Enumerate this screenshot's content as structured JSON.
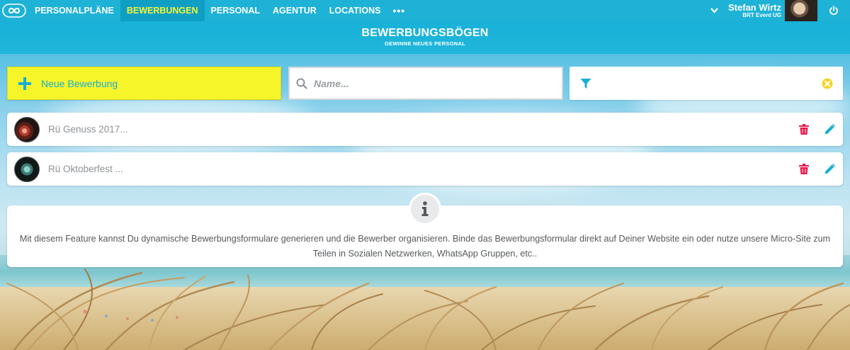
{
  "nav": {
    "items": [
      {
        "label": "PERSONALPLÄNE",
        "active": false
      },
      {
        "label": "BEWERBUNGEN",
        "active": true
      },
      {
        "label": "PERSONAL",
        "active": false
      },
      {
        "label": "AGENTUR",
        "active": false
      },
      {
        "label": "LOCATIONS",
        "active": false
      }
    ],
    "more": "•••",
    "user_name": "Stefan Wirtz",
    "user_company": "BRT Event UG"
  },
  "header": {
    "title": "BEWERBUNGSBÖGEN",
    "subtitle": "GEWINNE NEUES PERSONAL"
  },
  "toolbar": {
    "new_label": "Neue Bewerbung",
    "search_placeholder": "Name...",
    "search_value": ""
  },
  "list": [
    {
      "title": "Rü Genuss 2017..."
    },
    {
      "title": "Rü Oktoberfest ..."
    }
  ],
  "info": {
    "text": "Mit diesem Feature kannst Du dynamische Bewerbungsformulare generieren und die Bewerber organisieren. Binde das Bewerbungsformular direkt auf Deiner Website ein oder nutze unsere Micro-Site zum Teilen in Sozialen Netzwerken, WhatsApp Gruppen, etc.."
  },
  "colors": {
    "nav_bg": "#1eb2d6",
    "active_text": "#f5f533",
    "new_button_bg": "#f6f52a",
    "accent": "#19aed3",
    "delete": "#e8174b",
    "clear": "#f2d52a"
  },
  "icons": {
    "logo": "infinity-logo-icon",
    "chevron": "chevron-down-icon",
    "power": "power-icon",
    "plus": "plus-icon",
    "search": "search-icon",
    "filter": "filter-icon",
    "clear": "clear-circle-icon",
    "trash": "trash-icon",
    "pencil": "pencil-icon",
    "info": "info-icon"
  }
}
